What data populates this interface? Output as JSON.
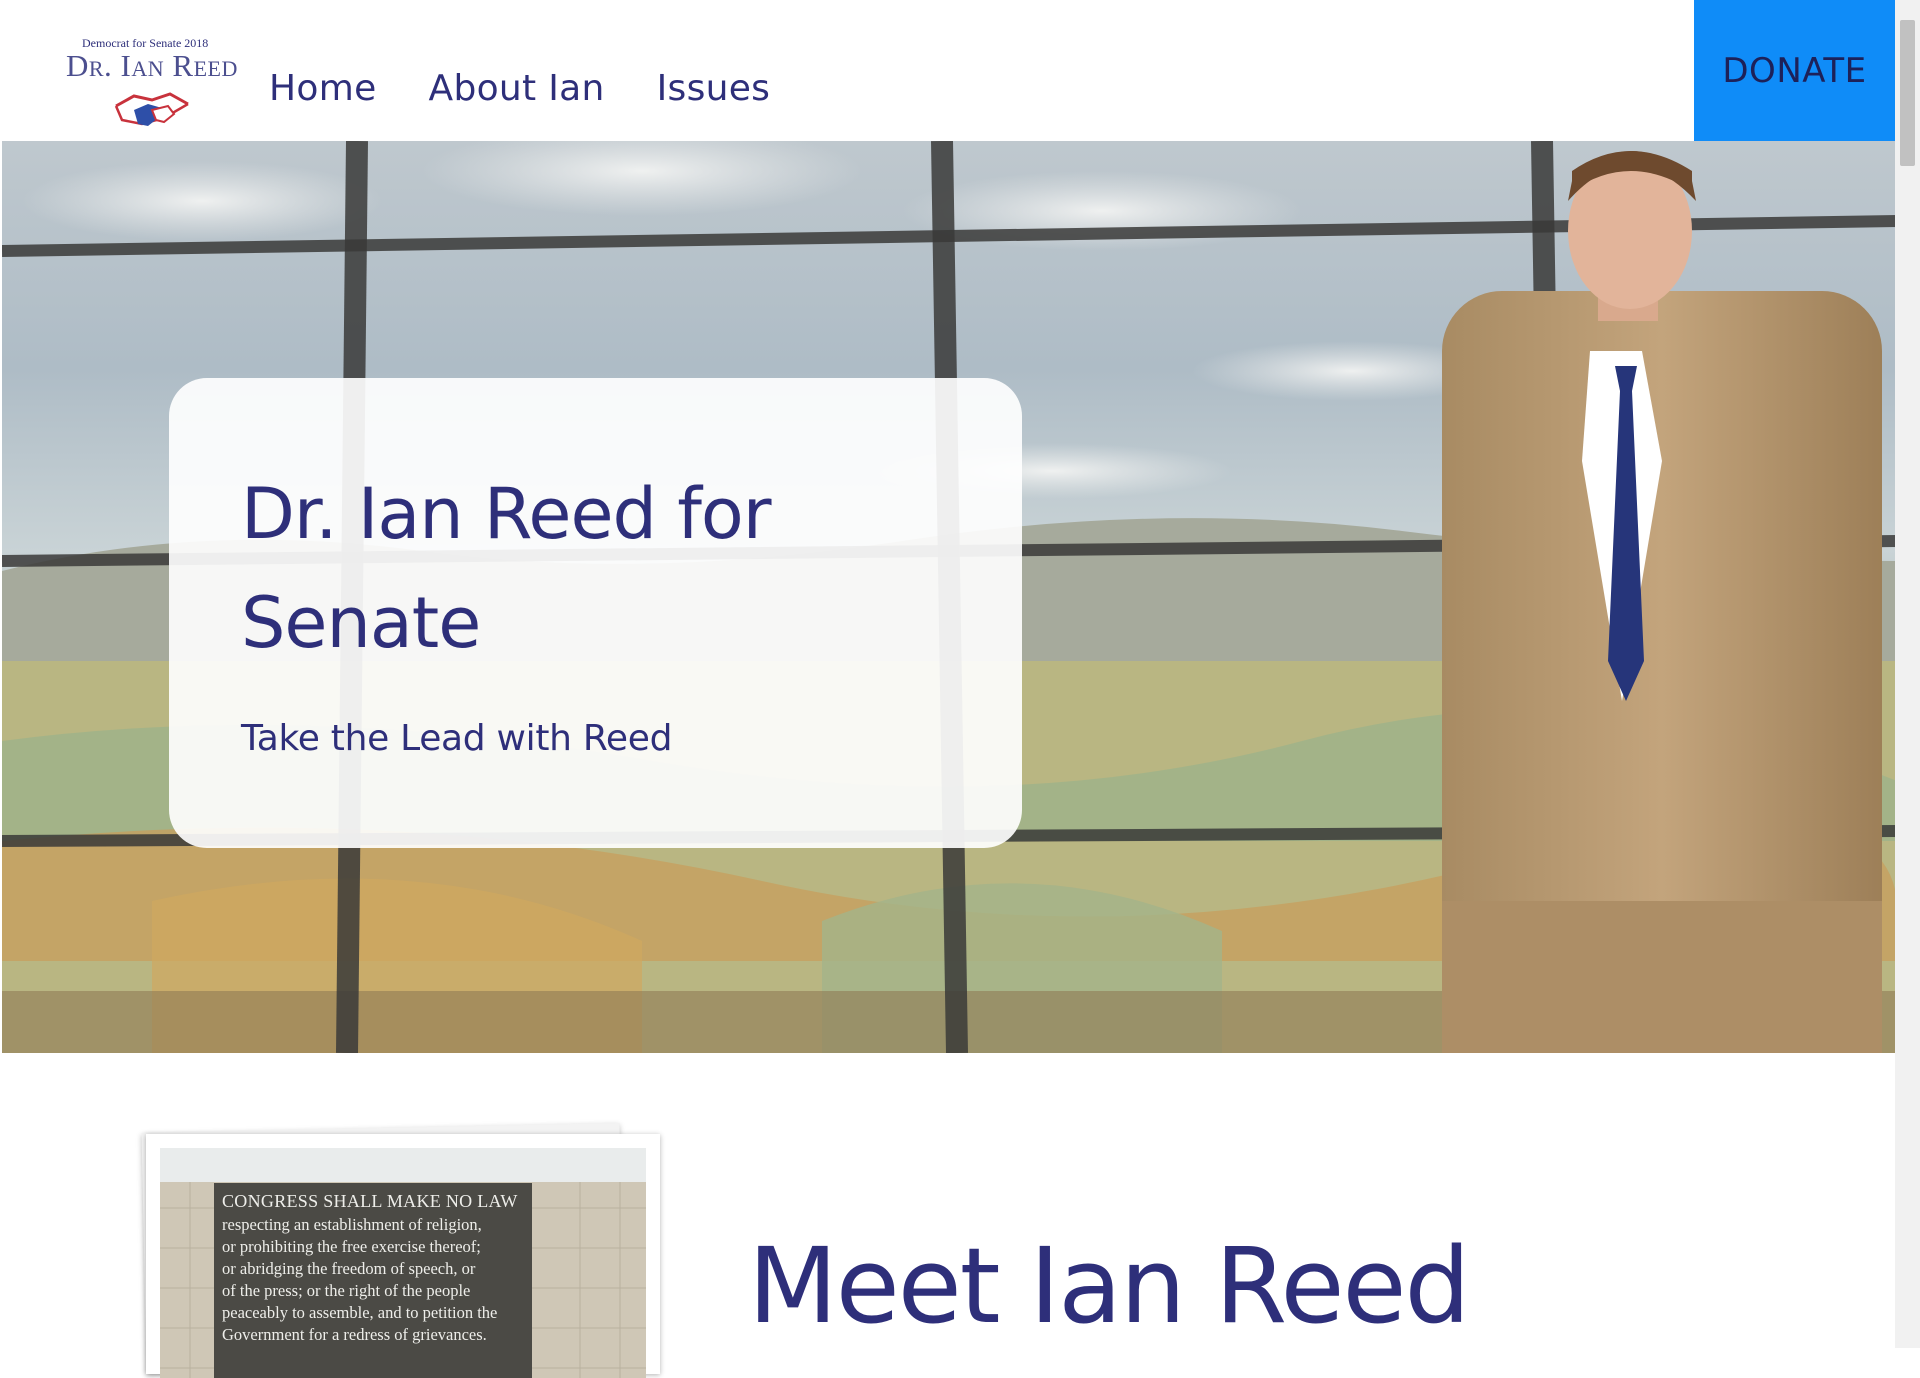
{
  "header": {
    "logo": {
      "tagline": "Democrat  for Senate 2018",
      "name": "Dr. Ian Reed"
    },
    "nav": [
      {
        "label": "Home"
      },
      {
        "label": "About Ian"
      },
      {
        "label": "Issues"
      }
    ],
    "donate_label": "DONATE"
  },
  "hero": {
    "title": "Dr. Ian Reed for Senate",
    "subtitle": "Take the Lead with Reed"
  },
  "meet": {
    "title": "Meet Ian Reed",
    "photo_plaque": {
      "heading": "CONGRESS SHALL MAKE NO LAW",
      "lines": [
        "respecting an establishment of religion,",
        "or prohibiting the free exercise thereof;",
        "or abridging the freedom of speech, or",
        "of the press; or the right of the people",
        "peaceably to assemble, and to petition the",
        "Government for a redress of grievances."
      ]
    }
  },
  "colors": {
    "brand_navy": "#2e2f7a",
    "donate_blue": "#0f8cf8"
  }
}
